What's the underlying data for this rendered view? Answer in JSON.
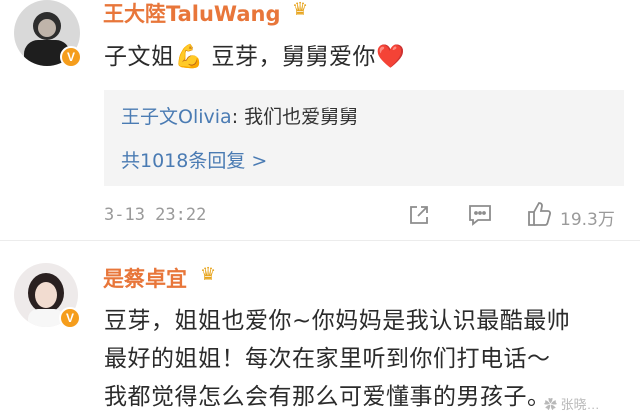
{
  "comments": [
    {
      "username": "王大陸TaluWang",
      "crown_icon": "crown-icon",
      "verified_badge": "V",
      "content": "子文姐💪 豆芽，舅舅爱你❤️",
      "reply_preview": {
        "reply_user": "王子文Olivia",
        "reply_text": ": 我们也爱舅舅",
        "replies_link": "共1018条回复 >"
      },
      "timestamp": "3-13 23:22",
      "likes": "19.3万"
    },
    {
      "username": "是蔡卓宜",
      "crown_icon": "crown-icon",
      "verified_badge": "V",
      "content_lines": [
        "豆芽，姐姐也爱你~你妈妈是我认识最酷最帅",
        "最好的姐姐！每次在家里听到你们打电话～",
        "我都觉得怎么会有那么可爱懂事的男孩子。"
      ]
    }
  ],
  "watermark": "✿ 张晓…"
}
